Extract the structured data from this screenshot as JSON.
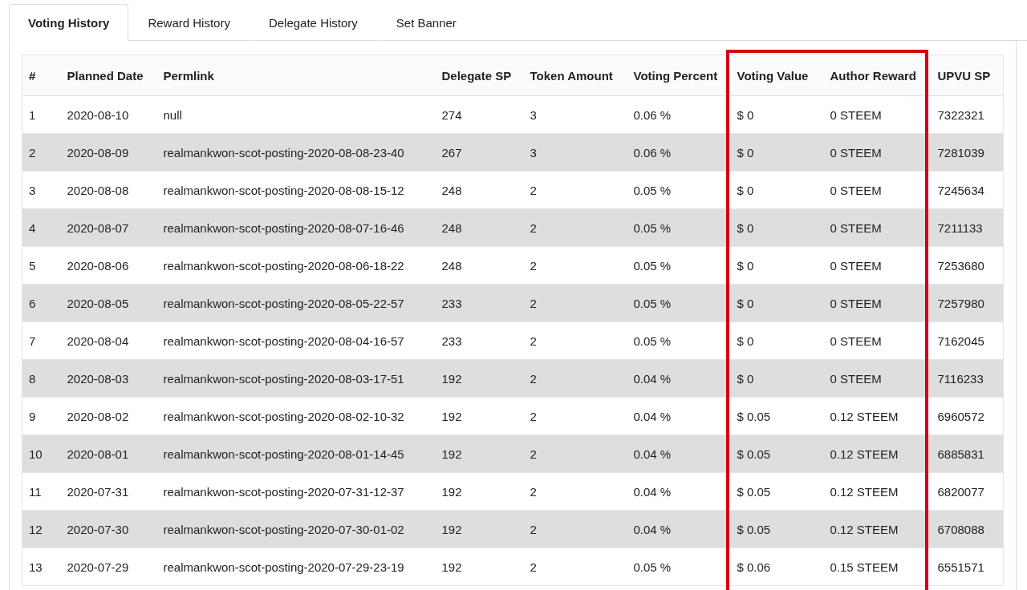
{
  "tabs": [
    {
      "label": "Voting History",
      "selected": true
    },
    {
      "label": "Reward History",
      "selected": false
    },
    {
      "label": "Delegate History",
      "selected": false
    },
    {
      "label": "Set Banner",
      "selected": false
    }
  ],
  "table": {
    "columns": [
      {
        "label": "#",
        "highlighted": false
      },
      {
        "label": "Planned Date",
        "highlighted": false
      },
      {
        "label": "Permlink",
        "highlighted": false
      },
      {
        "label": "Delegate SP",
        "highlighted": false
      },
      {
        "label": "Token Amount",
        "highlighted": false
      },
      {
        "label": "Voting Percent",
        "highlighted": false
      },
      {
        "label": "Voting Value",
        "highlighted": true
      },
      {
        "label": "Author Reward",
        "highlighted": true
      },
      {
        "label": "UPVU SP",
        "highlighted": false
      }
    ],
    "rows": [
      [
        "1",
        "2020-08-10",
        "null",
        "274",
        "3",
        "0.06 %",
        "$ 0",
        "0 STEEM",
        "7322321"
      ],
      [
        "2",
        "2020-08-09",
        "realmankwon-scot-posting-2020-08-08-23-40",
        "267",
        "3",
        "0.06 %",
        "$ 0",
        "0 STEEM",
        "7281039"
      ],
      [
        "3",
        "2020-08-08",
        "realmankwon-scot-posting-2020-08-08-15-12",
        "248",
        "2",
        "0.05 %",
        "$ 0",
        "0 STEEM",
        "7245634"
      ],
      [
        "4",
        "2020-08-07",
        "realmankwon-scot-posting-2020-08-07-16-46",
        "248",
        "2",
        "0.05 %",
        "$ 0",
        "0 STEEM",
        "7211133"
      ],
      [
        "5",
        "2020-08-06",
        "realmankwon-scot-posting-2020-08-06-18-22",
        "248",
        "2",
        "0.05 %",
        "$ 0",
        "0 STEEM",
        "7253680"
      ],
      [
        "6",
        "2020-08-05",
        "realmankwon-scot-posting-2020-08-05-22-57",
        "233",
        "2",
        "0.05 %",
        "$ 0",
        "0 STEEM",
        "7257980"
      ],
      [
        "7",
        "2020-08-04",
        "realmankwon-scot-posting-2020-08-04-16-57",
        "233",
        "2",
        "0.05 %",
        "$ 0",
        "0 STEEM",
        "7162045"
      ],
      [
        "8",
        "2020-08-03",
        "realmankwon-scot-posting-2020-08-03-17-51",
        "192",
        "2",
        "0.04 %",
        "$ 0",
        "0 STEEM",
        "7116233"
      ],
      [
        "9",
        "2020-08-02",
        "realmankwon-scot-posting-2020-08-02-10-32",
        "192",
        "2",
        "0.04 %",
        "$ 0.05",
        "0.12 STEEM",
        "6960572"
      ],
      [
        "10",
        "2020-08-01",
        "realmankwon-scot-posting-2020-08-01-14-45",
        "192",
        "2",
        "0.04 %",
        "$ 0.05",
        "0.12 STEEM",
        "6885831"
      ],
      [
        "11",
        "2020-07-31",
        "realmankwon-scot-posting-2020-07-31-12-37",
        "192",
        "2",
        "0.04 %",
        "$ 0.05",
        "0.12 STEEM",
        "6820077"
      ],
      [
        "12",
        "2020-07-30",
        "realmankwon-scot-posting-2020-07-30-01-02",
        "192",
        "2",
        "0.04 %",
        "$ 0.05",
        "0.12 STEEM",
        "6708088"
      ],
      [
        "13",
        "2020-07-29",
        "realmankwon-scot-posting-2020-07-29-23-19",
        "192",
        "2",
        "0.05 %",
        "$ 0.06",
        "0.15 STEEM",
        "6551571"
      ]
    ]
  }
}
